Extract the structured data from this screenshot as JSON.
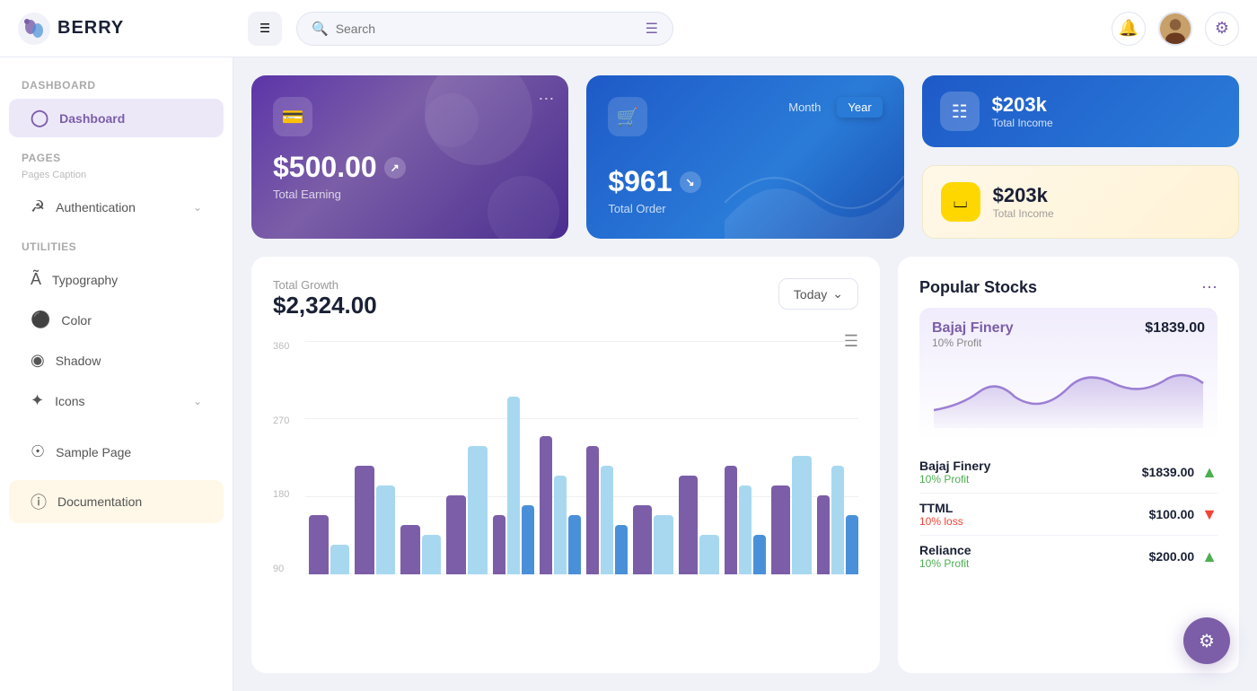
{
  "app": {
    "name": "BERRY"
  },
  "topbar": {
    "search_placeholder": "Search",
    "hamburger_icon": "☰",
    "notification_icon": "🔔",
    "settings_icon": "⚙"
  },
  "sidebar": {
    "dashboard_section": "Dashboard",
    "pages_section": "Pages",
    "pages_caption": "Pages Caption",
    "utilities_section": "Utilities",
    "items": {
      "dashboard": "Dashboard",
      "authentication": "Authentication",
      "typography": "Typography",
      "color": "Color",
      "shadow": "Shadow",
      "icons": "Icons",
      "sample_page": "Sample Page",
      "documentation": "Documentation"
    }
  },
  "cards": {
    "earning": {
      "amount": "$500.00",
      "label": "Total Earning"
    },
    "order": {
      "amount": "$961",
      "label": "Total Order",
      "toggle_month": "Month",
      "toggle_year": "Year"
    },
    "stat1": {
      "amount": "$203k",
      "label": "Total Income"
    },
    "stat2": {
      "amount": "$203k",
      "label": "Total Income"
    }
  },
  "growth": {
    "title": "Total Growth",
    "amount": "$2,324.00",
    "today_btn": "Today",
    "y_labels": [
      "360",
      "270",
      "180",
      "90"
    ],
    "bars": [
      {
        "purple": 30,
        "light": 15,
        "blue": 0
      },
      {
        "purple": 55,
        "light": 45,
        "blue": 0
      },
      {
        "purple": 25,
        "light": 20,
        "blue": 0
      },
      {
        "purple": 40,
        "light": 65,
        "blue": 0
      },
      {
        "purple": 30,
        "light": 90,
        "blue": 35
      },
      {
        "purple": 70,
        "light": 50,
        "blue": 30
      },
      {
        "purple": 65,
        "light": 55,
        "blue": 25
      },
      {
        "purple": 35,
        "light": 30,
        "blue": 0
      },
      {
        "purple": 50,
        "light": 20,
        "blue": 0
      },
      {
        "purple": 55,
        "light": 45,
        "blue": 20
      },
      {
        "purple": 45,
        "light": 60,
        "blue": 0
      },
      {
        "purple": 40,
        "light": 55,
        "blue": 30
      }
    ]
  },
  "stocks": {
    "title": "Popular Stocks",
    "featured": {
      "name": "Bajaj Finery",
      "price": "$1839.00",
      "profit": "10% Profit"
    },
    "list": [
      {
        "name": "Bajaj Finery",
        "profit": "10% Profit",
        "price": "$1839.00",
        "trend": "up"
      },
      {
        "name": "TTML",
        "profit": "10% loss",
        "price": "$100.00",
        "trend": "down"
      },
      {
        "name": "Reliance",
        "profit": "10% Profit",
        "price": "$200.00",
        "trend": "up"
      }
    ]
  }
}
